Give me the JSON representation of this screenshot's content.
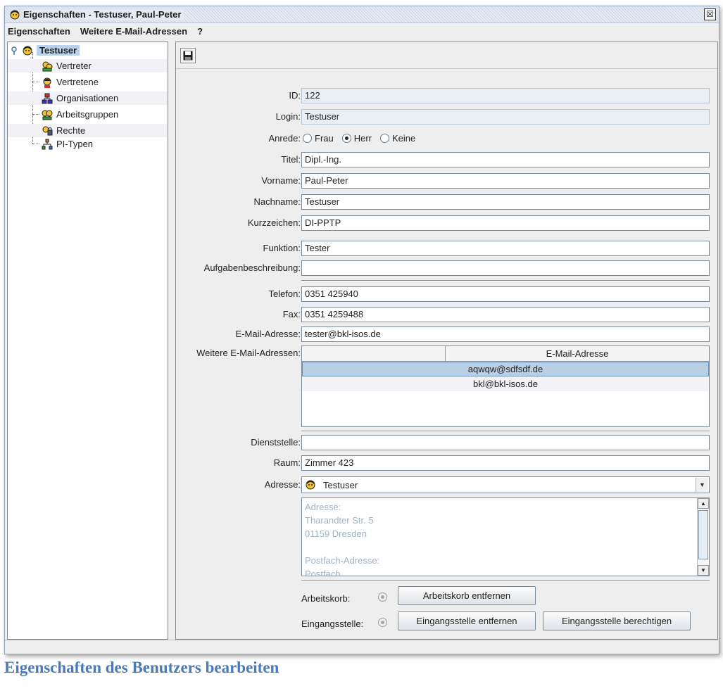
{
  "window": {
    "title": "Eigenschaften - Testuser, Paul-Peter",
    "close_glyph": "☒"
  },
  "menu": [
    "Eigenschaften",
    "Weitere E-Mail-Adressen",
    "?"
  ],
  "tree": {
    "root": "Testuser",
    "items": [
      {
        "label": "Vertreter",
        "icon": "vertreter-icon"
      },
      {
        "label": "Vertretene",
        "icon": "vertretene-icon"
      },
      {
        "label": "Organisationen",
        "icon": "organisation-icon"
      },
      {
        "label": "Arbeitsgruppen",
        "icon": "workgroup-icon"
      },
      {
        "label": "Rechte",
        "icon": "rights-icon"
      },
      {
        "label": "PI-Typen",
        "icon": "pi-types-icon"
      }
    ]
  },
  "form": {
    "id": {
      "label": "ID:",
      "value": "122"
    },
    "login": {
      "label": "Login:",
      "value": "Testuser"
    },
    "anrede": {
      "label": "Anrede:",
      "options": [
        "Frau",
        "Herr",
        "Keine"
      ],
      "selected": "Herr"
    },
    "titel": {
      "label": "Titel:",
      "value": "Dipl.-Ing."
    },
    "vorname": {
      "label": "Vorname:",
      "value": "Paul-Peter"
    },
    "nachname": {
      "label": "Nachname:",
      "value": "Testuser"
    },
    "kurzzeichen": {
      "label": "Kurzzeichen:",
      "value": "DI-PPTP"
    },
    "funktion": {
      "label": "Funktion:",
      "value": "Tester"
    },
    "aufgaben": {
      "label": "Aufgabenbeschreibung:",
      "value": ""
    },
    "telefon": {
      "label": "Telefon:",
      "value": "0351 425940"
    },
    "fax": {
      "label": "Fax:",
      "value": "0351 4259488"
    },
    "email": {
      "label": "E-Mail-Adresse:",
      "value": "tester@bkl-isos.de"
    },
    "weitere": {
      "label": "Weitere E-Mail-Adressen:",
      "column": "E-Mail-Adresse",
      "rows": [
        "aqwqw@sdfsdf.de",
        "bkl@bkl-isos.de"
      ]
    },
    "dienststelle": {
      "label": "Dienststelle:",
      "value": ""
    },
    "raum": {
      "label": "Raum:",
      "value": "Zimmer 423"
    },
    "adresse": {
      "label": "Adresse:",
      "value": "Testuser",
      "details": [
        "Adresse:",
        "Tharandter Str. 5",
        "01159 Dresden",
        "",
        "Postfach-Adresse:",
        "Postfach"
      ]
    },
    "arbeitskorb": {
      "label": "Arbeitskorb:",
      "button": "Arbeitskorb entfernen"
    },
    "eingangsstelle": {
      "label": "Eingangsstelle:",
      "button_remove": "Eingangsstelle entfernen",
      "button_authorize": "Eingangsstelle berechtigen"
    }
  },
  "caption": "Eigenschaften des Benutzers bearbeiten"
}
